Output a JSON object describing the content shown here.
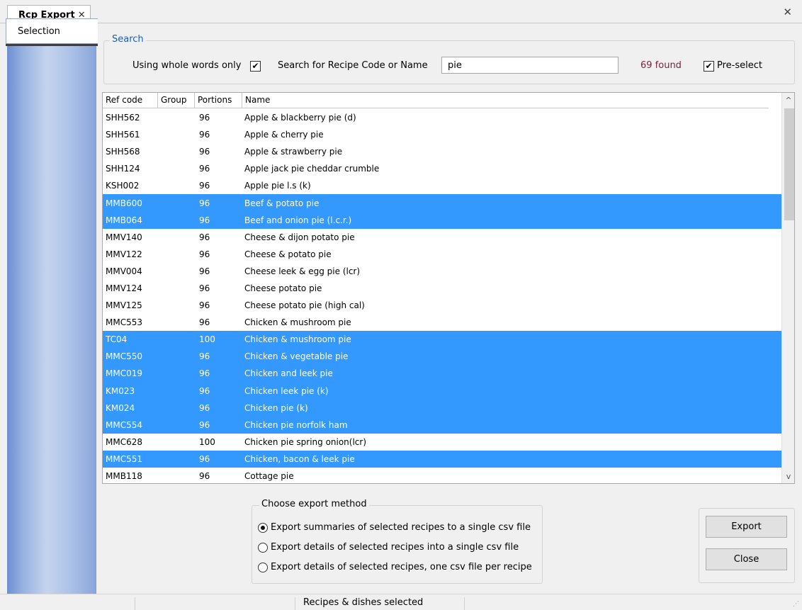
{
  "tab": {
    "title": "Rcp Export",
    "close": "✕"
  },
  "window": {
    "close": "✕"
  },
  "sidebar": {
    "tab_label": "Selection"
  },
  "search": {
    "group_title": "Search",
    "whole_words_label": "Using whole words only",
    "whole_words_checked": "✔",
    "search_label": "Search for Recipe Code or Name",
    "search_value": "pie",
    "found_text": "69 found",
    "preselect_label": "Pre-select",
    "preselect_checked": "✔"
  },
  "table": {
    "columns": [
      "Ref code",
      "Group",
      "Portions",
      "Name"
    ],
    "rows": [
      {
        "ref": "SHH562",
        "portions": "96",
        "name": "Apple & blackberry pie (d)",
        "selected": false
      },
      {
        "ref": "SHH561",
        "portions": "96",
        "name": "Apple & cherry pie",
        "selected": false
      },
      {
        "ref": "SHH568",
        "portions": "96",
        "name": "Apple & strawberry pie",
        "selected": false
      },
      {
        "ref": "SHH124",
        "portions": "96",
        "name": "Apple jack pie cheddar crumble",
        "selected": false
      },
      {
        "ref": "KSH002",
        "portions": "96",
        "name": "Apple pie l.s (k)",
        "selected": false
      },
      {
        "ref": "MMB600",
        "portions": "96",
        "name": "Beef & potato pie",
        "selected": true
      },
      {
        "ref": "MMB064",
        "portions": "96",
        "name": "Beef and onion pie (l.c.r.)",
        "selected": true
      },
      {
        "ref": "MMV140",
        "portions": "96",
        "name": "Cheese & dijon potato pie",
        "selected": false
      },
      {
        "ref": "MMV122",
        "portions": "96",
        "name": "Cheese & potato pie",
        "selected": false
      },
      {
        "ref": "MMV004",
        "portions": "96",
        "name": "Cheese leek & egg pie (lcr)",
        "selected": false
      },
      {
        "ref": "MMV124",
        "portions": "96",
        "name": "Cheese potato pie",
        "selected": false
      },
      {
        "ref": "MMV125",
        "portions": "96",
        "name": "Cheese potato pie (high cal)",
        "selected": false
      },
      {
        "ref": "MMC553",
        "portions": "96",
        "name": "Chicken & mushroom pie",
        "selected": false
      },
      {
        "ref": "TC04",
        "portions": "100",
        "name": "Chicken & mushroom pie",
        "selected": true
      },
      {
        "ref": "MMC550",
        "portions": "96",
        "name": "Chicken & vegetable pie",
        "selected": true
      },
      {
        "ref": "MMC019",
        "portions": "96",
        "name": "Chicken and leek pie",
        "selected": true
      },
      {
        "ref": "KM023",
        "portions": "96",
        "name": "Chicken leek pie (k)",
        "selected": true
      },
      {
        "ref": "KM024",
        "portions": "96",
        "name": "Chicken pie (k)",
        "selected": true
      },
      {
        "ref": "MMC554",
        "portions": "96",
        "name": "Chicken pie norfolk ham",
        "selected": true
      },
      {
        "ref": "MMC628",
        "portions": "100",
        "name": "Chicken pie spring onion(lcr)",
        "selected": false
      },
      {
        "ref": "MMC551",
        "portions": "96",
        "name": "Chicken, bacon & leek pie",
        "selected": true
      },
      {
        "ref": "MMB118",
        "portions": "96",
        "name": "Cottage pie",
        "selected": false
      }
    ],
    "scroll_up": "^",
    "scroll_down": "v"
  },
  "export": {
    "group_title": "Choose export method",
    "options": [
      {
        "label": "Export summaries of selected recipes to a single csv file",
        "checked": true
      },
      {
        "label": "Export details of selected recipes into a single csv file",
        "checked": false
      },
      {
        "label": "Export details of selected recipes, one csv file per recipe",
        "checked": false
      }
    ]
  },
  "buttons": {
    "export": "Export",
    "close": "Close"
  },
  "status": {
    "text": "Recipes & dishes selected"
  },
  "colors": {
    "selection": "#3399ff",
    "found": "#7a1f3d",
    "group_title": "#1f5fb8"
  }
}
